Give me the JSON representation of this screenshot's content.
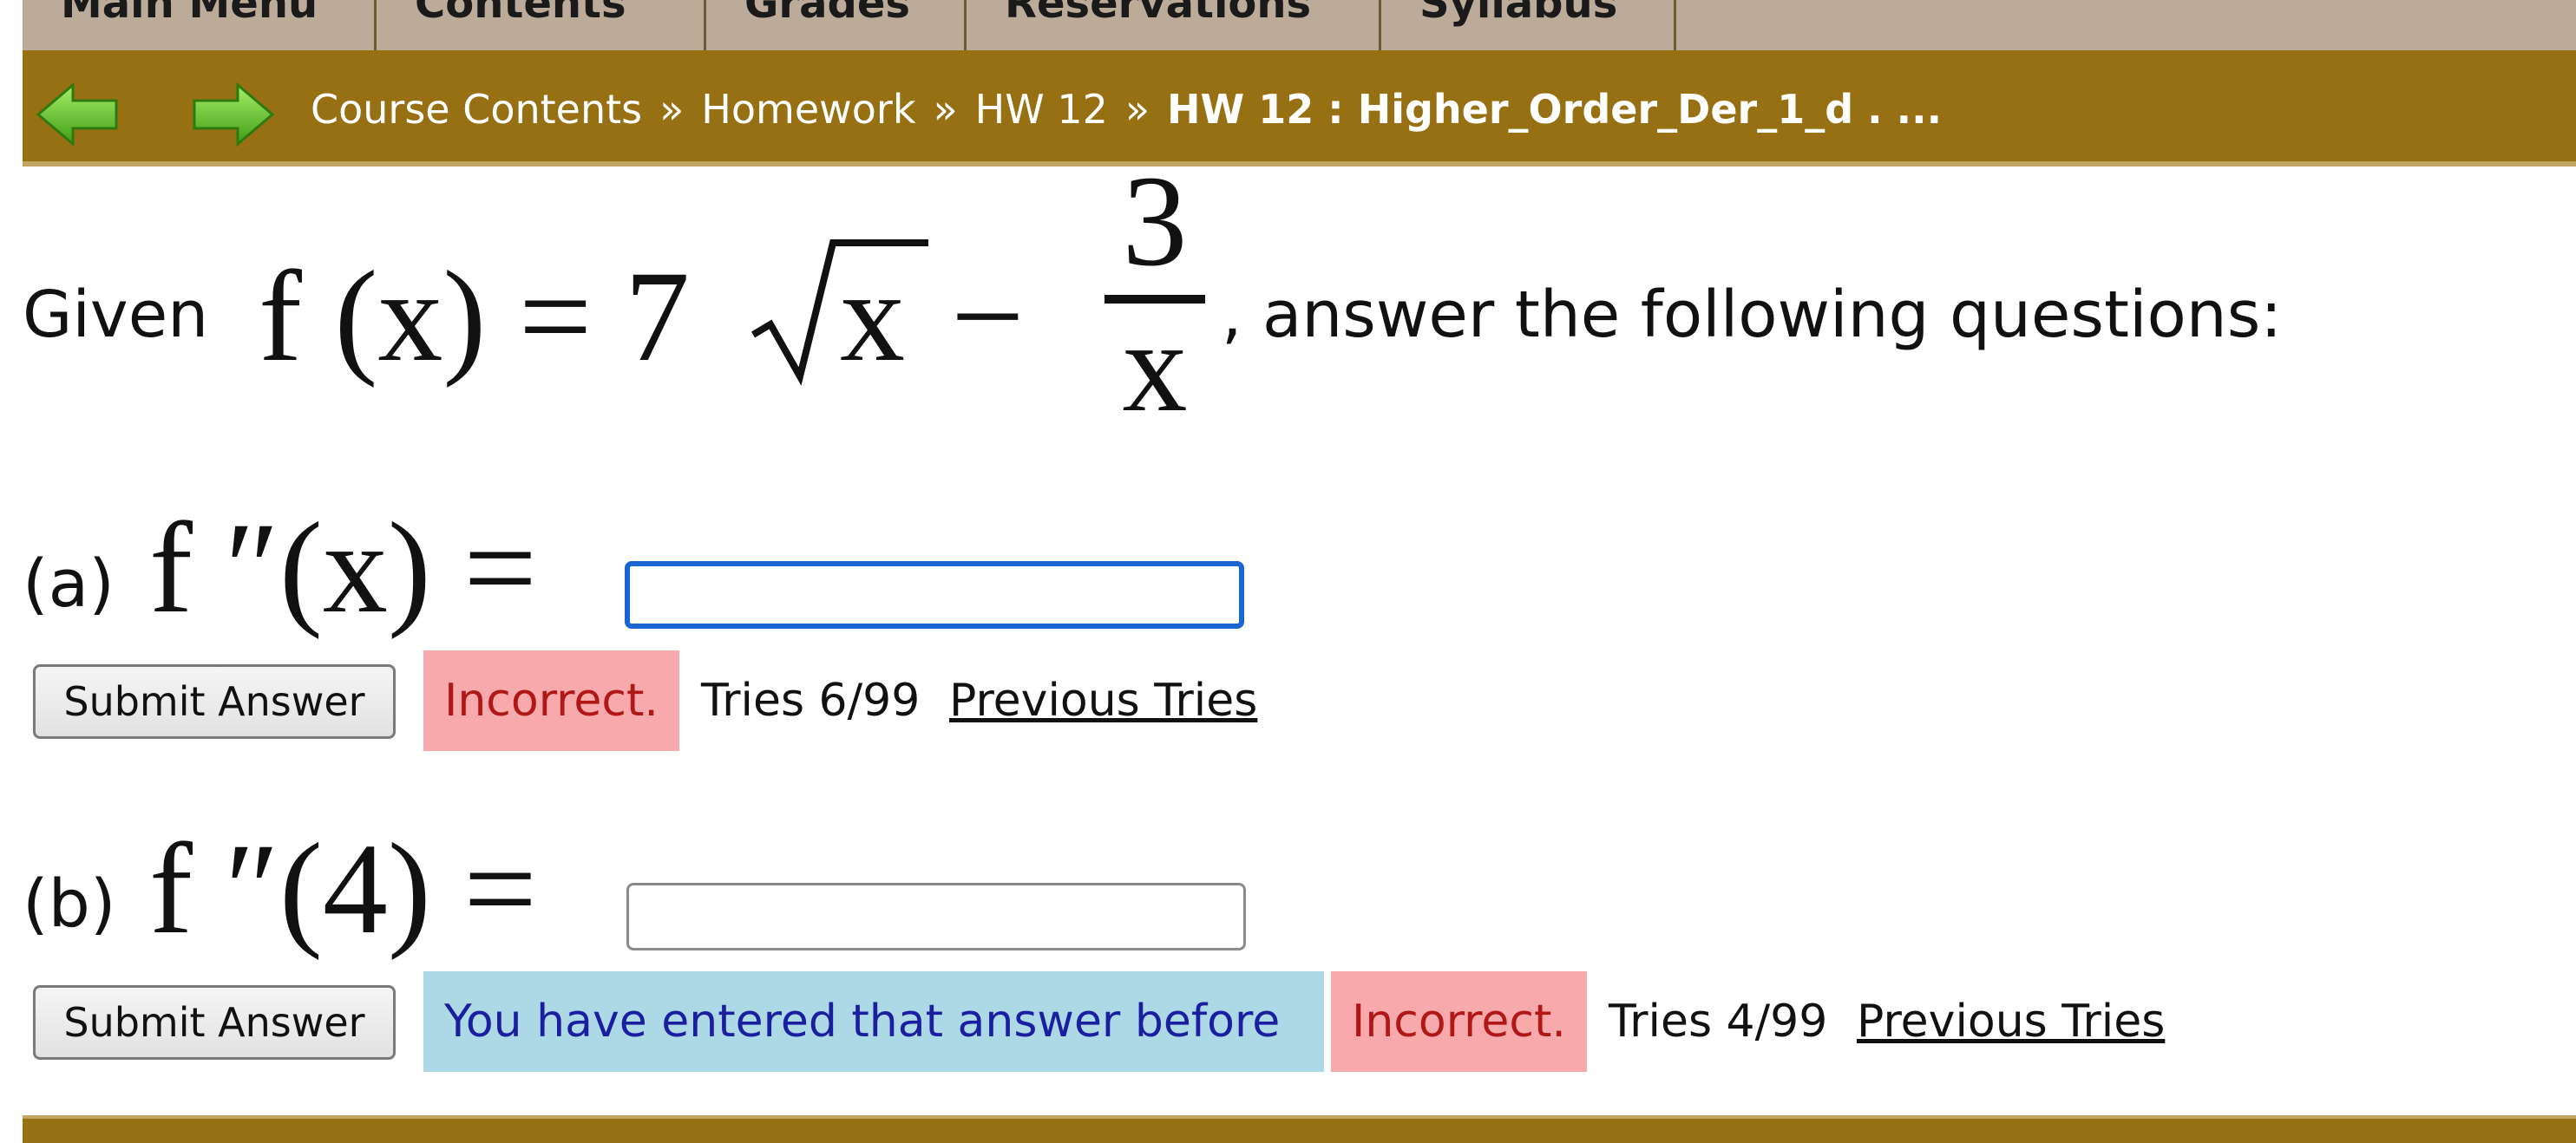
{
  "menu": {
    "tabs": [
      {
        "label": "Main Menu"
      },
      {
        "label": "Contents"
      },
      {
        "label": "Grades"
      },
      {
        "label": "Reservations"
      },
      {
        "label": "Syllabus"
      }
    ]
  },
  "breadcrumb": {
    "items": [
      "Course Contents",
      "Homework",
      "HW 12"
    ],
    "separator": "»",
    "current": "HW 12 : Higher_Order_Der_1_d . ..."
  },
  "problem": {
    "given_label": "Given",
    "function_lhs": "f (x) = 7",
    "radicand": "x",
    "minus": "−",
    "frac_num": "3",
    "frac_den": "x",
    "tail": ", answer the following questions:"
  },
  "part_a": {
    "label": "(a)",
    "expr": "f ″(x) =",
    "input_value": "",
    "submit_label": "Submit Answer",
    "status": "Incorrect.",
    "tries": "Tries 6/99",
    "previous_tries": "Previous Tries"
  },
  "part_b": {
    "label": "(b)",
    "expr": "f ″(4) =",
    "input_value": "",
    "submit_label": "Submit Answer",
    "notice": "You have entered that answer before",
    "status": "Incorrect.",
    "tries": "Tries 4/99",
    "previous_tries": "Previous Tries"
  },
  "colors": {
    "menu_bg": "#bcab98",
    "breadcrumb_bg": "#967012",
    "incorrect_bg": "#f8a9ab",
    "incorrect_text": "#b01818",
    "notice_bg": "#add8e5",
    "notice_text": "#1a1fa0",
    "focus_border": "#1a64d3",
    "arrow_green": "#5fc12a"
  },
  "icons": {
    "back": "back-arrow-icon",
    "forward": "forward-arrow-icon"
  }
}
